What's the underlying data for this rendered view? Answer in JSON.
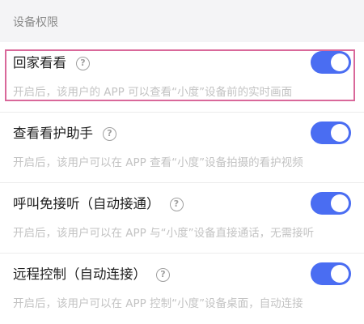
{
  "section": {
    "title": "设备权限"
  },
  "permissions": [
    {
      "title": "回家看看",
      "desc": "开启后，该用户的 APP 可以查看“小度”设备前的实时画面",
      "enabled": true
    },
    {
      "title": "查看看护助手",
      "desc": "开启后，该用户可以在 APP 查看“小度”设备拍摄的看护视频",
      "enabled": true
    },
    {
      "title": "呼叫免接听（自动接通）",
      "desc": "开启后，该用户可以在 APP 与“小度”设备直接通话，无需接听",
      "enabled": true
    },
    {
      "title": "远程控制（自动连接）",
      "desc": "开启后，该用户可以在 APP 控制“小度”设备桌面，自动连接",
      "enabled": true
    }
  ],
  "help_icon": "question-circle-icon",
  "colors": {
    "toggle_on": "#4a6df2",
    "highlight_border": "#d9689a",
    "description_text": "#c3c3c3",
    "section_title": "#8b8b8b"
  }
}
